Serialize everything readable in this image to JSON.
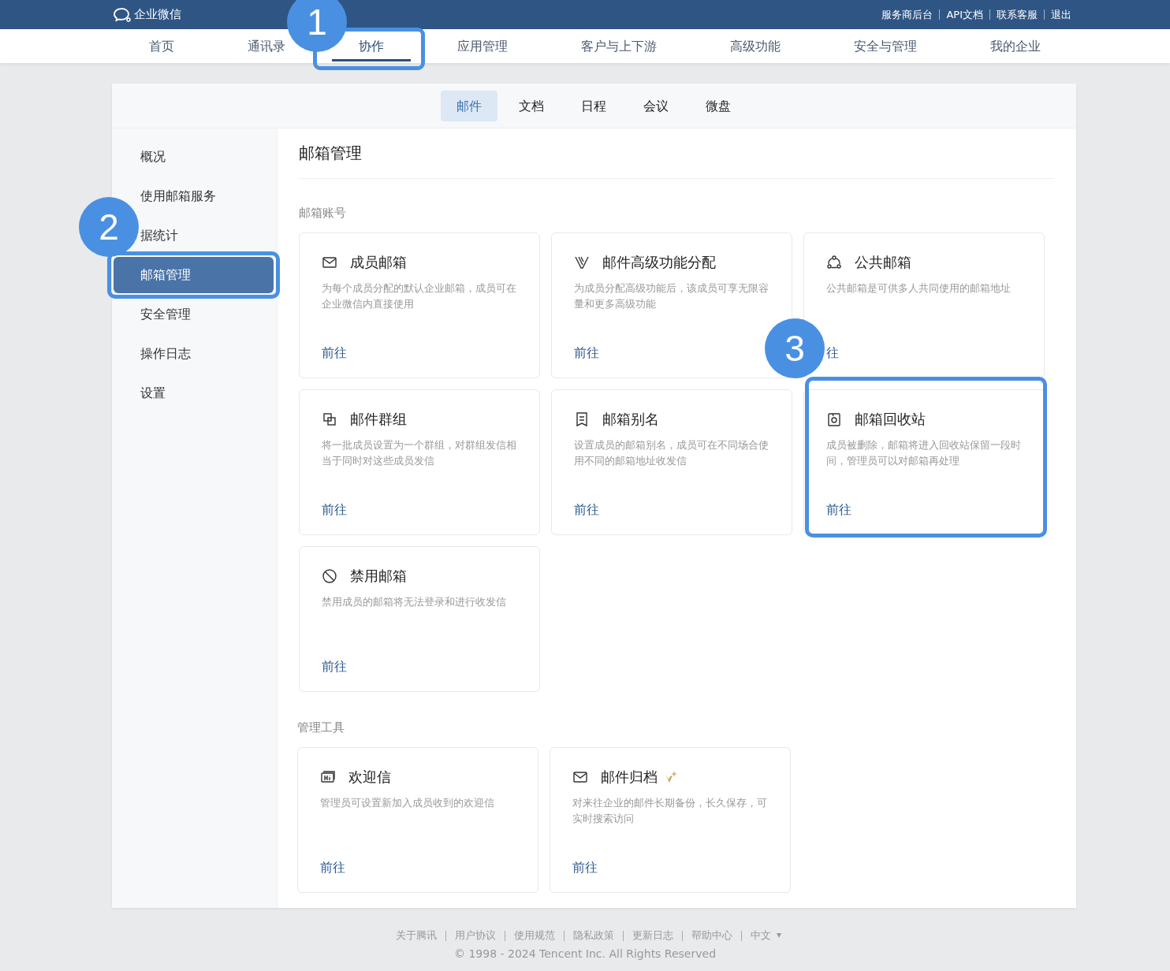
{
  "top_bar": {
    "logo": "企业微信",
    "links": [
      "服务商后台",
      "API文档",
      "联系客服",
      "退出"
    ]
  },
  "nav": [
    {
      "label": "首页",
      "selected": false
    },
    {
      "label": "通讯录",
      "selected": false
    },
    {
      "label": "协作",
      "selected": true,
      "callout": "1"
    },
    {
      "label": "应用管理",
      "selected": false
    },
    {
      "label": "客户与上下游",
      "selected": false
    },
    {
      "label": "高级功能",
      "selected": false
    },
    {
      "label": "安全与管理",
      "selected": false
    },
    {
      "label": "我的企业",
      "selected": false
    }
  ],
  "subtabs": [
    {
      "label": "邮件",
      "selected": true
    },
    {
      "label": "文档",
      "selected": false
    },
    {
      "label": "日程",
      "selected": false
    },
    {
      "label": "会议",
      "selected": false
    },
    {
      "label": "微盘",
      "selected": false
    }
  ],
  "sidebar": [
    {
      "label": "概况",
      "selected": false
    },
    {
      "label": "使用邮箱服务",
      "selected": false
    },
    {
      "label": "据统计",
      "selected": false
    },
    {
      "label": "邮箱管理",
      "selected": true,
      "callout": "2"
    },
    {
      "label": "安全管理",
      "selected": false
    },
    {
      "label": "操作日志",
      "selected": false
    },
    {
      "label": "设置",
      "selected": false
    }
  ],
  "page_title": "邮箱管理",
  "sections": [
    {
      "title": "邮箱账号",
      "cards": [
        {
          "title": "成员邮箱",
          "description": "为每个成员分配的默认企业邮箱，成员可在企业微信内直接使用",
          "link": "前往",
          "premium": false
        },
        {
          "title": "邮件高级功能分配",
          "description": "为成员分配高级功能后，该成员可享无限容量和更多高级功能",
          "link": "前往",
          "premium": false
        },
        {
          "title": "公共邮箱",
          "description": "公共邮箱是可供多人共同使用的邮箱地址",
          "link": "往",
          "premium": false
        },
        {
          "title": "邮件群组",
          "description": "将一批成员设置为一个群组，对群组发信相当于同时对这些成员发信",
          "link": "前往",
          "premium": false
        },
        {
          "title": "邮箱别名",
          "description": "设置成员的邮箱别名，成员可在不同场合使用不同的邮箱地址收发信",
          "link": "前往",
          "premium": false
        },
        {
          "title": "邮箱回收站",
          "description": "成员被删除，邮箱将进入回收站保留一段时间，管理员可以对邮箱再处理",
          "link": "前往",
          "premium": false,
          "callout": "3"
        },
        {
          "title": "禁用邮箱",
          "description": "禁用成员的邮箱将无法登录和进行收发信",
          "link": "前往",
          "premium": false
        }
      ]
    },
    {
      "title": "管理工具",
      "cards": [
        {
          "title": "欢迎信",
          "description": "管理员可设置新加入成员收到的欢迎信",
          "link": "前往",
          "premium": false
        },
        {
          "title": "邮件归档",
          "description": "对来往企业的邮件长期备份，长久保存，可实时搜索访问",
          "link": "前往",
          "premium": true
        }
      ]
    }
  ],
  "footer": {
    "links": [
      "关于腾讯",
      "用户协议",
      "使用规范",
      "隐私政策",
      "更新日志",
      "帮助中心"
    ],
    "language": "中文",
    "copyright": "© 1998 - 2024 Tencent Inc. All Rights Reserved"
  }
}
